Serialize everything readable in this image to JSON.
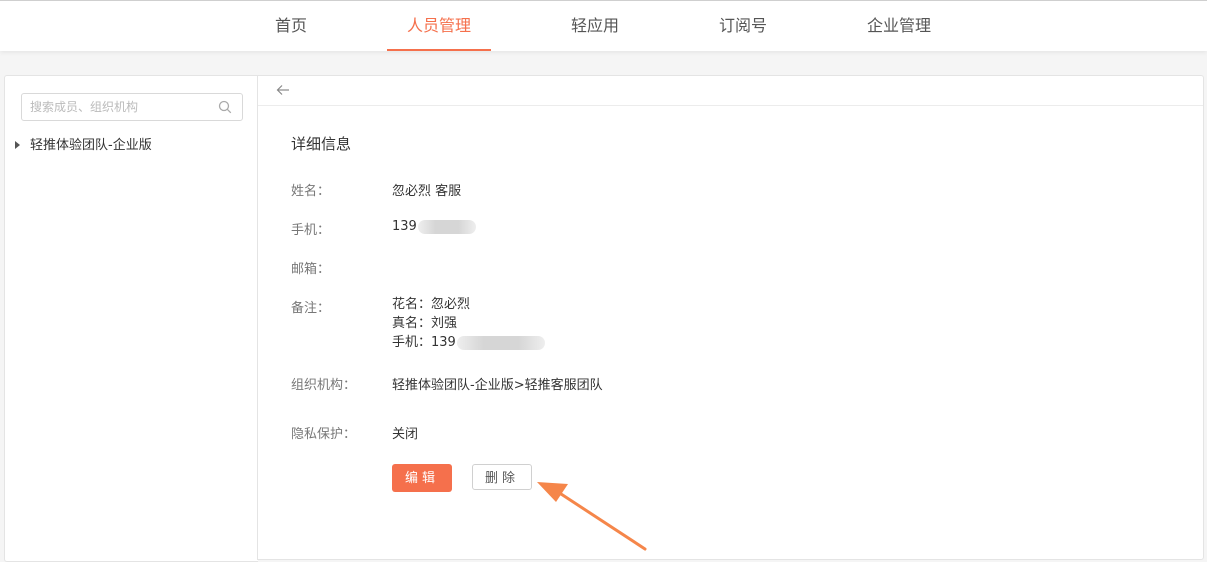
{
  "nav": {
    "items": [
      {
        "label": "首页"
      },
      {
        "label": "人员管理",
        "active": true
      },
      {
        "label": "轻应用"
      },
      {
        "label": "订阅号"
      },
      {
        "label": "企业管理"
      }
    ]
  },
  "sidebar": {
    "search_placeholder": "搜索成员、组织机构",
    "search_icon": "search-icon",
    "tree": [
      {
        "label": "轻推体验团队-企业版"
      }
    ]
  },
  "detail": {
    "back_icon": "arrow-left-icon",
    "title": "详细信息",
    "name_label": "姓名：",
    "name_value": "忽必烈 客服",
    "phone_label": "手机：",
    "phone_value": "139",
    "email_label": "邮箱：",
    "email_value": "",
    "remark_label": "备注：",
    "remark_lines": [
      "花名：忽必烈",
      "真名：刘强",
      "手机：139"
    ],
    "org_label": "组织机构：",
    "org_value": "轻推体验团队-企业版>轻推客服团队",
    "privacy_label": "隐私保护：",
    "privacy_value": "关闭",
    "edit_label": "编辑",
    "delete_label": "删除"
  },
  "colors": {
    "accent": "#f5704c",
    "annotation_arrow": "#f5864a"
  }
}
